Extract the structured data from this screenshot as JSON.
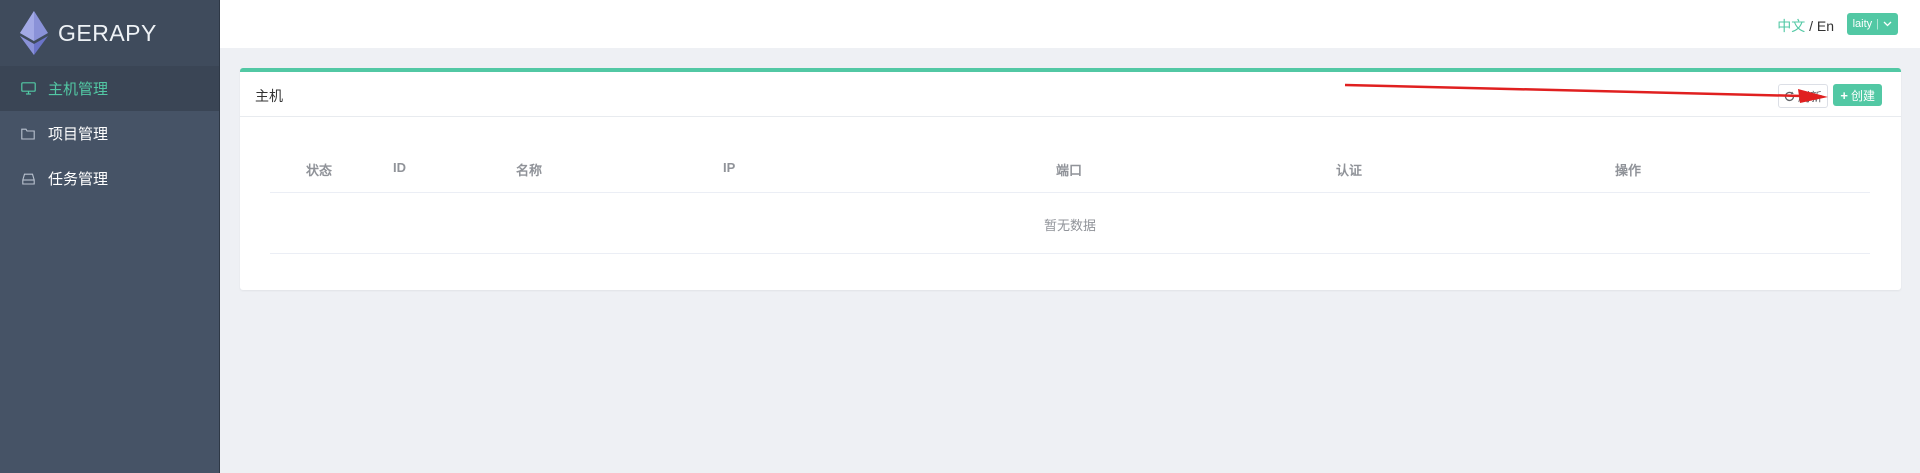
{
  "brand": {
    "name": "GERAPY"
  },
  "sidebar": {
    "items": [
      {
        "label": "主机管理",
        "icon": "monitor-icon",
        "active": true
      },
      {
        "label": "项目管理",
        "icon": "folder-icon",
        "active": false
      },
      {
        "label": "任务管理",
        "icon": "inbox-icon",
        "active": false
      }
    ]
  },
  "topbar": {
    "lang_zh": "中文",
    "lang_sep": " / ",
    "lang_en": "En",
    "user": "laity"
  },
  "panel": {
    "title": "主机",
    "refresh_label": "刷新",
    "create_label": "创建"
  },
  "table": {
    "columns": [
      "状态",
      "ID",
      "名称",
      "IP",
      "端口",
      "认证",
      "操作"
    ],
    "empty_text": "暂无数据"
  },
  "colors": {
    "accent": "#52c8a4",
    "sidebar": "#465366",
    "annotation_arrow": "#e02020"
  }
}
